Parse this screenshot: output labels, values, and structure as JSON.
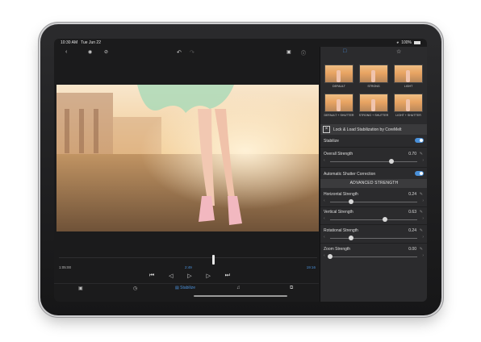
{
  "status": {
    "time": "10:30 AM",
    "date": "Tue Jun 22",
    "battery": "100%"
  },
  "timeline": {
    "start": "1:05:00",
    "current": "2:49",
    "end": "19:16"
  },
  "bottom_bar": {
    "stabilize_label": "Stabilize"
  },
  "presets": [
    {
      "label": "DEFAULT"
    },
    {
      "label": "STRONG"
    },
    {
      "label": "LIGHT"
    },
    {
      "label": "DEFAULT + SHUTTER"
    },
    {
      "label": "STRONG + SHUTTER"
    },
    {
      "label": "LIGHT + SHUTTER"
    }
  ],
  "plugin": {
    "title": "Lock & Load Stabilization by CoreMelt"
  },
  "settings": {
    "stabilize_label": "Stabilize",
    "stabilize_on": true,
    "overall_strength_label": "Overall Strength",
    "overall_strength_value": "0.70",
    "overall_strength_level": 0.7,
    "auto_shutter_label": "Automatic Shutter Correction",
    "auto_shutter_on": true,
    "advanced_header": "ADVANCED STRENGTH",
    "horizontal_label": "Horizontal Strength",
    "horizontal_value": "0.24",
    "horizontal_level": 0.24,
    "vertical_label": "Vertical Strength",
    "vertical_value": "0.63",
    "vertical_level": 0.63,
    "rotational_label": "Rotational Strength",
    "rotational_value": "0.24",
    "rotational_level": 0.24,
    "zoom_label": "Zoom Strength",
    "zoom_value": "0.00",
    "zoom_level": 0.0
  },
  "colors": {
    "accent": "#4a90d9",
    "panel": "#2b2b2d",
    "background": "#1b1b1c"
  },
  "icons": [
    "back-icon",
    "eye-icon",
    "eye-slash-icon",
    "undo-icon",
    "redo-icon",
    "snapshot-icon",
    "help-icon",
    "film-icon",
    "star-icon",
    "wifi-icon",
    "battery-icon"
  ]
}
